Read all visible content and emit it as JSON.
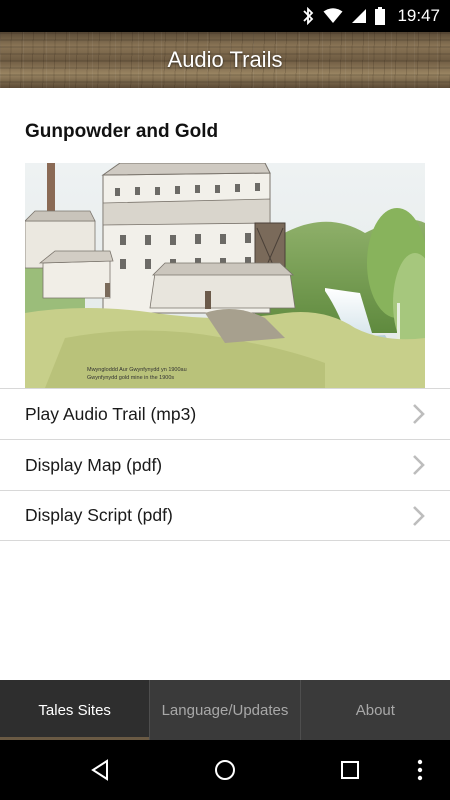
{
  "status_bar": {
    "time": "19:47",
    "icons": [
      "bluetooth-icon",
      "wifi-icon",
      "signal-icon",
      "battery-icon"
    ]
  },
  "app_bar": {
    "title": "Audio Trails"
  },
  "main": {
    "title": "Gunpowder and Gold",
    "image": {
      "caption_line1": "Mwyngloddd Aur Gwynfynydd yn 1900au",
      "caption_line2": "Gwynfynydd gold mine in the 1900s"
    },
    "items": [
      {
        "label": "Play Audio Trail (mp3)",
        "icon": "chevron-right-icon"
      },
      {
        "label": "Display Map (pdf)",
        "icon": "chevron-right-icon"
      },
      {
        "label": "Display Script (pdf)",
        "icon": "chevron-right-icon"
      }
    ]
  },
  "tabs": [
    {
      "label": "Tales Sites",
      "active": true
    },
    {
      "label": "Language/Updates",
      "active": false
    },
    {
      "label": "About",
      "active": false
    }
  ],
  "nav": {
    "buttons": [
      "back-icon",
      "home-icon",
      "recents-icon",
      "more-icon"
    ]
  },
  "colors": {
    "tab_bar": "#3a3a3a",
    "tab_active_indicator": "#6a5a44",
    "divider": "#d8d8d8",
    "chevron": "#bdbdbd"
  }
}
